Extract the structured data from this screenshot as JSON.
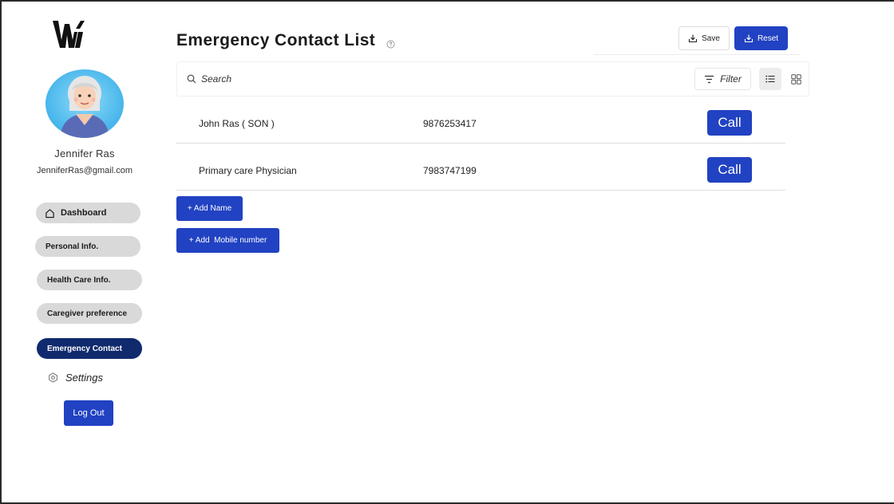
{
  "sidebar": {
    "logo_icon": "wi-logo-icon",
    "avatar_icon": "elderly-woman-avatar",
    "user_name": "Jennifer Ras",
    "user_email": "JenniferRas@gmail.com",
    "nav": {
      "dashboard": "Dashboard",
      "personal": "Personal Info.",
      "health": "Health Care Info.",
      "caregiver": "Caregiver preference",
      "emergency": "Emergency Contact"
    },
    "settings_label": "Settings",
    "logout_label": "Log Out"
  },
  "header": {
    "title": "Emergency Contact List",
    "save_label": "Save",
    "reset_label": "Reset"
  },
  "toolbar": {
    "search_placeholder": "Search",
    "filter_label": "Filter"
  },
  "contacts": [
    {
      "name": "John Ras ( SON )",
      "phone": "9876253417",
      "call_label": "Call"
    },
    {
      "name": "Primary care Physician",
      "phone": "7983747199",
      "call_label": "Call"
    }
  ],
  "actions": {
    "add_name": "+ Add Name",
    "add_mobile": "+ Add  Mobile number"
  },
  "colors": {
    "primary": "#2142c2",
    "nav_active": "#102a6e",
    "nav_inactive": "#d9d9d9"
  }
}
